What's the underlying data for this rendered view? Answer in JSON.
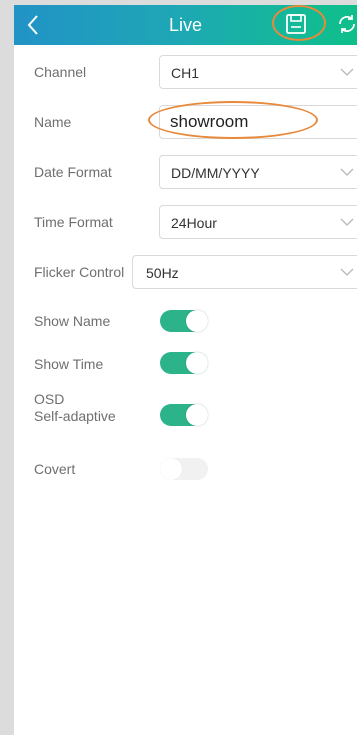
{
  "header": {
    "title": "Live",
    "back_icon": "chevron-left-icon",
    "save_icon": "floppy-disk-icon",
    "refresh_icon": "refresh-icon"
  },
  "settings": {
    "channel": {
      "label": "Channel",
      "value": "CH1"
    },
    "name": {
      "label": "Name",
      "value": "showroom"
    },
    "date_format": {
      "label": "Date Format",
      "value": "DD/MM/YYYY"
    },
    "time_format": {
      "label": "Time Format",
      "value": "24Hour"
    },
    "flicker_control": {
      "label": "Flicker Control",
      "value": "50Hz"
    },
    "show_name": {
      "label": "Show Name",
      "enabled": true
    },
    "show_time": {
      "label": "Show Time",
      "enabled": true
    },
    "osd_self_adaptive": {
      "label_line1": "OSD",
      "label_line2": "Self-adaptive",
      "enabled": true
    },
    "covert": {
      "label": "Covert",
      "enabled": false
    }
  },
  "colors": {
    "header_gradient_start": "#2193c6",
    "header_gradient_end": "#0fbf8a",
    "toggle_on": "#2db38a",
    "highlight_annotation": "#e8893c"
  }
}
